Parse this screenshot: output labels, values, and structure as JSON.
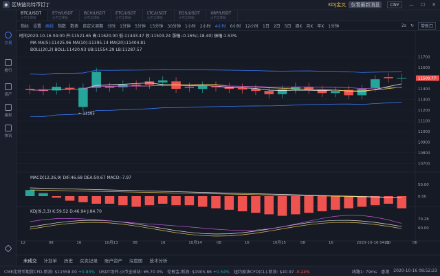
{
  "window": {
    "title": "区块链比特币钉丁",
    "ticker_name": "KDJ金叉",
    "ticker_badge": "仅看最新消息",
    "currency": "CNY"
  },
  "sidebar": {
    "items": [
      {
        "label": "交易"
      },
      {
        "label": "看行"
      },
      {
        "label": "资产"
      },
      {
        "label": "接权"
      },
      {
        "label": "快讯"
      }
    ]
  },
  "tabs": [
    {
      "label": "BTC/USDT",
      "sub": "火币全球站"
    },
    {
      "label": "ETH/USDT",
      "sub": "火币全球站"
    },
    {
      "label": "BCH/USDT",
      "sub": "火币全球站"
    },
    {
      "label": "ETC/USDT",
      "sub": "火币全球站"
    },
    {
      "label": "LTC/USDT",
      "sub": "火币全球站"
    },
    {
      "label": "EOS/USDT",
      "sub": "火币全球站"
    },
    {
      "label": "XRP/USDT",
      "sub": "火币全球站"
    }
  ],
  "toolbar": {
    "items": [
      "指标",
      "设置",
      "画线",
      "指数",
      "数表"
    ],
    "custom": "自定义周期",
    "periods": [
      "分时",
      "1分钟",
      "5分钟",
      "15分钟",
      "30分钟",
      "1小时",
      "2小时",
      "4小时",
      "6小时",
      "12小时",
      "1日",
      "2日",
      "5日",
      "周K",
      "月K",
      "年K",
      "1分钟"
    ],
    "active_period": "4小时",
    "refresh": "2s",
    "right_select": "带新口"
  },
  "info": {
    "line1": "时间2020-10-16 04:00  开:11521.65  高:11620.00  低:11443.47  收:11503.24  涨幅:-0.16%(-18.40)  振幅:1.53%",
    "ma": "MA   MA(5):11425.96   MA(10):11395.14   MA(20):11404.81",
    "boll": "BOLL(20,2)  BOLL:11420.93  UB:11554.29  LB:11287.57",
    "macd": "MACD(12,26,9)  DIF:46.68  DEA:50.67  MACD:-7.97",
    "kdj": "KDJ(9,3,3)  K:59.52  D:46.94  J:84.70"
  },
  "chart_data": {
    "type": "candlestick",
    "x_ticks": [
      "12",
      "08",
      "16",
      "10月13",
      "08",
      "16",
      "10月14",
      "08",
      "16",
      "10月15",
      "08",
      "16",
      "2020-10-16 04:00",
      "21",
      "06"
    ],
    "y_ticks": [
      11700,
      11600,
      11500,
      11400,
      11300,
      11200,
      11100,
      11000,
      10900,
      10800,
      10700
    ],
    "last_price": 11500.77,
    "low_marker": "11185",
    "macd_axis": [
      "50.00",
      "0.00"
    ],
    "kdj_axis": [
      "70.28",
      "60.00"
    ],
    "candles": [
      {
        "o": 11400,
        "c": 11390
      },
      {
        "o": 11395,
        "c": 11380
      },
      {
        "o": 11385,
        "c": 11420
      },
      {
        "o": 11410,
        "c": 11395
      },
      {
        "o": 11230,
        "c": 11410
      },
      {
        "o": 11410,
        "c": 11560
      },
      {
        "o": 11420,
        "c": 11410
      },
      {
        "o": 11415,
        "c": 11440
      },
      {
        "o": 11440,
        "c": 11430
      },
      {
        "o": 11470,
        "c": 11440
      },
      {
        "o": 11460,
        "c": 11480
      },
      {
        "o": 11470,
        "c": 11400
      },
      {
        "o": 11420,
        "c": 11410
      },
      {
        "o": 11400,
        "c": 11430
      },
      {
        "o": 11430,
        "c": 11415
      },
      {
        "o": 11420,
        "c": 11400
      },
      {
        "o": 11410,
        "c": 11395
      },
      {
        "o": 11400,
        "c": 11380
      },
      {
        "o": 11380,
        "c": 11350
      },
      {
        "o": 11350,
        "c": 11395
      },
      {
        "o": 11395,
        "c": 11420
      },
      {
        "o": 11420,
        "c": 11390
      },
      {
        "o": 11390,
        "c": 11360
      },
      {
        "o": 11360,
        "c": 11380
      },
      {
        "o": 11390,
        "c": 11340
      },
      {
        "o": 11340,
        "c": 11400
      },
      {
        "o": 11410,
        "c": 11490
      },
      {
        "o": 11510,
        "c": 11500
      },
      {
        "o": 11500,
        "c": 11503
      }
    ],
    "macd": [
      4,
      2,
      -1,
      -3,
      -4,
      -5,
      -5,
      -6,
      -7,
      -6,
      -5,
      -6,
      -6,
      -7,
      -8,
      -9,
      -10,
      -11,
      -12,
      -13,
      -12,
      -11,
      -10,
      -9,
      -8,
      -7,
      -6,
      -5,
      -8
    ]
  },
  "bottom_tabs": [
    "未成交",
    "计划单",
    "历史",
    "买卖记录",
    "账户资产",
    "深度图",
    "技术分析"
  ],
  "statusbar": {
    "items": [
      {
        "label": "CME比特币期货CFD-新浪:",
        "value": "$11558.00",
        "chg": "+0.83%",
        "dir": "up"
      },
      {
        "label": "USDT场外-火币全球站:",
        "value": "¥6.70",
        "chg": "0%",
        "dir": "flat"
      },
      {
        "label": "伦敦金-新浪:",
        "value": "$1905.86",
        "chg": "+0.54%",
        "dir": "up"
      },
      {
        "label": "纽约原油CFD(CL)-新浪:",
        "value": "$40.97",
        "chg": "-0.24%",
        "dir": "dn"
      }
    ],
    "net": "线路1: 79ms",
    "sound": "香港",
    "datetime": "2020-10-16 08:52:23"
  }
}
